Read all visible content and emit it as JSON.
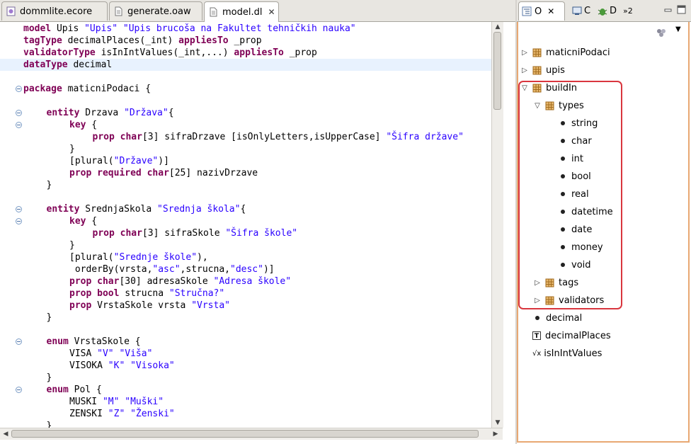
{
  "editor_tabs": [
    {
      "label": "dommlite.ecore",
      "icon": "ecore-icon"
    },
    {
      "label": "generate.oaw",
      "icon": "file-icon"
    },
    {
      "label": "model.dl",
      "icon": "file-icon",
      "close": "✕"
    }
  ],
  "code_lines": [
    {
      "fold": false,
      "cur": false,
      "indent": 0,
      "tokens": [
        [
          "kw",
          "model"
        ],
        [
          "pl",
          " Upis "
        ],
        [
          "str",
          "\"Upis\""
        ],
        [
          "pl",
          " "
        ],
        [
          "str",
          "\"Upis brucoša na Fakultet tehničkih nauka\""
        ]
      ]
    },
    {
      "fold": false,
      "cur": false,
      "indent": 0,
      "tokens": [
        [
          "kw",
          "tagType"
        ],
        [
          "pl",
          " decimalPlaces(_int) "
        ],
        [
          "kw",
          "appliesTo"
        ],
        [
          "pl",
          " _prop"
        ]
      ]
    },
    {
      "fold": false,
      "cur": false,
      "indent": 0,
      "tokens": [
        [
          "kw",
          "validatorType"
        ],
        [
          "pl",
          " isInIntValues(_int,...) "
        ],
        [
          "kw",
          "appliesTo"
        ],
        [
          "pl",
          " _prop"
        ]
      ]
    },
    {
      "fold": false,
      "cur": true,
      "indent": 0,
      "tokens": [
        [
          "kw",
          "dataType"
        ],
        [
          "pl",
          " decimal"
        ]
      ]
    },
    {
      "fold": false,
      "cur": false,
      "indent": 0,
      "tokens": []
    },
    {
      "fold": true,
      "cur": false,
      "indent": 0,
      "tokens": [
        [
          "kw",
          "package"
        ],
        [
          "pl",
          " maticniPodaci {"
        ]
      ]
    },
    {
      "fold": false,
      "cur": false,
      "indent": 0,
      "tokens": []
    },
    {
      "fold": true,
      "cur": false,
      "indent": 1,
      "tokens": [
        [
          "kw",
          "entity"
        ],
        [
          "pl",
          " Drzava "
        ],
        [
          "str",
          "\"Država\""
        ],
        [
          "pl",
          "{"
        ]
      ]
    },
    {
      "fold": true,
      "cur": false,
      "indent": 2,
      "tokens": [
        [
          "kw",
          "key"
        ],
        [
          "pl",
          " {"
        ]
      ]
    },
    {
      "fold": false,
      "cur": false,
      "indent": 3,
      "tokens": [
        [
          "kw",
          "prop"
        ],
        [
          "pl",
          " "
        ],
        [
          "kw",
          "char"
        ],
        [
          "pl",
          "[3] sifraDrzave [isOnlyLetters,isUpperCase] "
        ],
        [
          "str",
          "\"Šifra države\""
        ]
      ]
    },
    {
      "fold": false,
      "cur": false,
      "indent": 2,
      "tokens": [
        [
          "pl",
          "}"
        ]
      ]
    },
    {
      "fold": false,
      "cur": false,
      "indent": 2,
      "tokens": [
        [
          "pl",
          "[plural("
        ],
        [
          "str",
          "\"Države\""
        ],
        [
          "pl",
          ")]"
        ]
      ]
    },
    {
      "fold": false,
      "cur": false,
      "indent": 2,
      "tokens": [
        [
          "kw",
          "prop"
        ],
        [
          "pl",
          " "
        ],
        [
          "kw",
          "required"
        ],
        [
          "pl",
          " "
        ],
        [
          "kw",
          "char"
        ],
        [
          "pl",
          "[25] nazivDrzave"
        ]
      ]
    },
    {
      "fold": false,
      "cur": false,
      "indent": 1,
      "tokens": [
        [
          "pl",
          "}"
        ]
      ]
    },
    {
      "fold": false,
      "cur": false,
      "indent": 0,
      "tokens": []
    },
    {
      "fold": true,
      "cur": false,
      "indent": 1,
      "tokens": [
        [
          "kw",
          "entity"
        ],
        [
          "pl",
          " SrednjaSkola "
        ],
        [
          "str",
          "\"Srednja škola\""
        ],
        [
          "pl",
          "{"
        ]
      ]
    },
    {
      "fold": true,
      "cur": false,
      "indent": 2,
      "tokens": [
        [
          "kw",
          "key"
        ],
        [
          "pl",
          " {"
        ]
      ]
    },
    {
      "fold": false,
      "cur": false,
      "indent": 3,
      "tokens": [
        [
          "kw",
          "prop"
        ],
        [
          "pl",
          " "
        ],
        [
          "kw",
          "char"
        ],
        [
          "pl",
          "[3] sifraSkole "
        ],
        [
          "str",
          "\"Šifra škole\""
        ]
      ]
    },
    {
      "fold": false,
      "cur": false,
      "indent": 2,
      "tokens": [
        [
          "pl",
          "}"
        ]
      ]
    },
    {
      "fold": false,
      "cur": false,
      "indent": 2,
      "tokens": [
        [
          "pl",
          "[plural("
        ],
        [
          "str",
          "\"Srednje škole\""
        ],
        [
          "pl",
          "),"
        ]
      ]
    },
    {
      "fold": false,
      "cur": false,
      "indent": 2,
      "tokens": [
        [
          "pl",
          " orderBy(vrsta,"
        ],
        [
          "str",
          "\"asc\""
        ],
        [
          "pl",
          ",strucna,"
        ],
        [
          "str",
          "\"desc\""
        ],
        [
          "pl",
          ")]"
        ]
      ]
    },
    {
      "fold": false,
      "cur": false,
      "indent": 2,
      "tokens": [
        [
          "kw",
          "prop"
        ],
        [
          "pl",
          " "
        ],
        [
          "kw",
          "char"
        ],
        [
          "pl",
          "[30] adresaSkole "
        ],
        [
          "str",
          "\"Adresa škole\""
        ]
      ]
    },
    {
      "fold": false,
      "cur": false,
      "indent": 2,
      "tokens": [
        [
          "kw",
          "prop"
        ],
        [
          "pl",
          " "
        ],
        [
          "kw",
          "bool"
        ],
        [
          "pl",
          " strucna "
        ],
        [
          "str",
          "\"Stručna?\""
        ]
      ]
    },
    {
      "fold": false,
      "cur": false,
      "indent": 2,
      "tokens": [
        [
          "kw",
          "prop"
        ],
        [
          "pl",
          " VrstaSkole vrsta "
        ],
        [
          "str",
          "\"Vrsta\""
        ]
      ]
    },
    {
      "fold": false,
      "cur": false,
      "indent": 1,
      "tokens": [
        [
          "pl",
          "}"
        ]
      ]
    },
    {
      "fold": false,
      "cur": false,
      "indent": 0,
      "tokens": []
    },
    {
      "fold": true,
      "cur": false,
      "indent": 1,
      "tokens": [
        [
          "kw",
          "enum"
        ],
        [
          "pl",
          " VrstaSkole {"
        ]
      ]
    },
    {
      "fold": false,
      "cur": false,
      "indent": 2,
      "tokens": [
        [
          "pl",
          "VISA "
        ],
        [
          "str",
          "\"V\""
        ],
        [
          "pl",
          " "
        ],
        [
          "str",
          "\"Viša\""
        ]
      ]
    },
    {
      "fold": false,
      "cur": false,
      "indent": 2,
      "tokens": [
        [
          "pl",
          "VISOKA "
        ],
        [
          "str",
          "\"K\""
        ],
        [
          "pl",
          " "
        ],
        [
          "str",
          "\"Visoka\""
        ]
      ]
    },
    {
      "fold": false,
      "cur": false,
      "indent": 1,
      "tokens": [
        [
          "pl",
          "}"
        ]
      ]
    },
    {
      "fold": true,
      "cur": false,
      "indent": 1,
      "tokens": [
        [
          "kw",
          "enum"
        ],
        [
          "pl",
          " Pol {"
        ]
      ]
    },
    {
      "fold": false,
      "cur": false,
      "indent": 2,
      "tokens": [
        [
          "pl",
          "MUSKI "
        ],
        [
          "str",
          "\"M\""
        ],
        [
          "pl",
          " "
        ],
        [
          "str",
          "\"Muški\""
        ]
      ]
    },
    {
      "fold": false,
      "cur": false,
      "indent": 2,
      "tokens": [
        [
          "pl",
          "ZENSKI "
        ],
        [
          "str",
          "\"Z\""
        ],
        [
          "pl",
          " "
        ],
        [
          "str",
          "\"Ženski\""
        ]
      ]
    },
    {
      "fold": false,
      "cur": false,
      "indent": 1,
      "tokens": [
        [
          "pl",
          "}"
        ]
      ]
    }
  ],
  "outline_tabs": [
    {
      "label": "O",
      "icon": "outline-icon",
      "close": "✕"
    },
    {
      "label": "C",
      "icon": "console-icon"
    },
    {
      "label": "D",
      "icon": "debug-icon"
    },
    {
      "label": "»2",
      "icon": "overflow-icon"
    }
  ],
  "outline_items": [
    {
      "label": "maticniPodaci",
      "depth": 0,
      "twisty": "▷",
      "kind": "package"
    },
    {
      "label": "upis",
      "depth": 0,
      "twisty": "▷",
      "kind": "package"
    },
    {
      "label": "buildIn",
      "depth": 0,
      "twisty": "▽",
      "kind": "package"
    },
    {
      "label": "types",
      "depth": 1,
      "twisty": "▽",
      "kind": "package"
    },
    {
      "label": "string",
      "depth": 2,
      "twisty": "",
      "kind": "dot"
    },
    {
      "label": "char",
      "depth": 2,
      "twisty": "",
      "kind": "dot"
    },
    {
      "label": "int",
      "depth": 2,
      "twisty": "",
      "kind": "dot"
    },
    {
      "label": "bool",
      "depth": 2,
      "twisty": "",
      "kind": "dot"
    },
    {
      "label": "real",
      "depth": 2,
      "twisty": "",
      "kind": "dot"
    },
    {
      "label": "datetime",
      "depth": 2,
      "twisty": "",
      "kind": "dot"
    },
    {
      "label": "date",
      "depth": 2,
      "twisty": "",
      "kind": "dot"
    },
    {
      "label": "money",
      "depth": 2,
      "twisty": "",
      "kind": "dot"
    },
    {
      "label": "void",
      "depth": 2,
      "twisty": "",
      "kind": "dot"
    },
    {
      "label": "tags",
      "depth": 1,
      "twisty": "▷",
      "kind": "package"
    },
    {
      "label": "validators",
      "depth": 1,
      "twisty": "▷",
      "kind": "package"
    },
    {
      "label": "decimal",
      "depth": 0,
      "twisty": "",
      "kind": "dot"
    },
    {
      "label": "decimalPlaces",
      "depth": 0,
      "twisty": "",
      "kind": "tag"
    },
    {
      "label": "isInIntValues",
      "depth": 0,
      "twisty": "",
      "kind": "validator"
    }
  ],
  "glyphs": {
    "tag": "T",
    "validator": "√x",
    "view_menu": "▼",
    "scroll_up": "▲",
    "scroll_down": "▼",
    "scroll_left": "◀",
    "scroll_right": "▶"
  },
  "colors": {
    "keyword": "#7f0055",
    "string": "#2a00ff",
    "highlight": "#d9363e",
    "current_line": "#e8f2fe"
  }
}
